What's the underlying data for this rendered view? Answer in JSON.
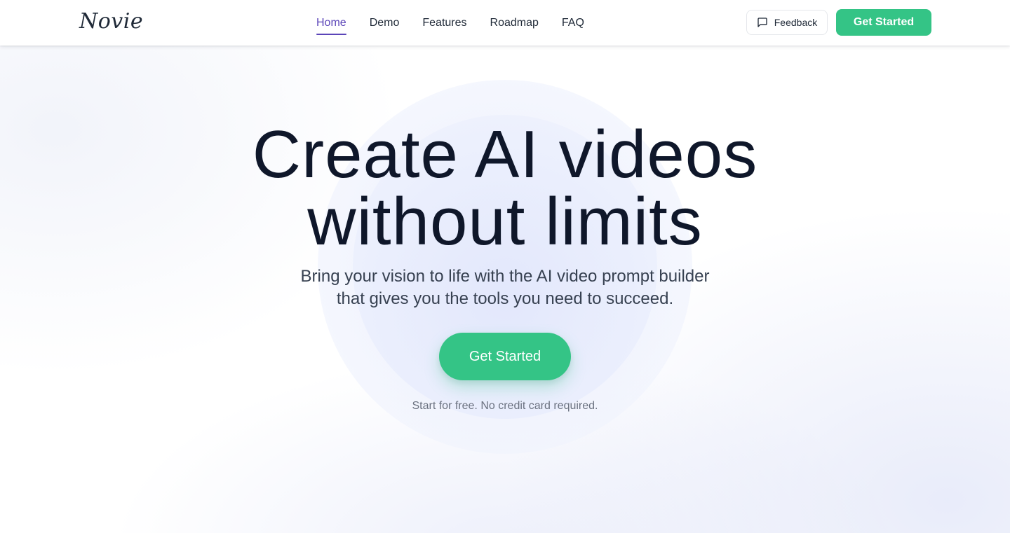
{
  "header": {
    "logo": "Novie",
    "nav": [
      {
        "label": "Home",
        "active": true
      },
      {
        "label": "Demo",
        "active": false
      },
      {
        "label": "Features",
        "active": false
      },
      {
        "label": "Roadmap",
        "active": false
      },
      {
        "label": "FAQ",
        "active": false
      }
    ],
    "feedback_label": "Feedback",
    "cta_label": "Get Started"
  },
  "hero": {
    "headline_line1": "Create AI videos",
    "headline_line2": "without limits",
    "subtitle_line1": "Bring your vision to life with the AI video prompt builder",
    "subtitle_line2": "that gives you the tools you need to succeed.",
    "cta_label": "Get Started",
    "note": "Start for free. No credit card required."
  },
  "icons": {
    "feedback": "message-square-icon"
  },
  "colors": {
    "accent_green": "#34c486",
    "nav_active": "#5b45b8",
    "text_dark": "#0f172a",
    "text_muted": "#6b7280"
  }
}
